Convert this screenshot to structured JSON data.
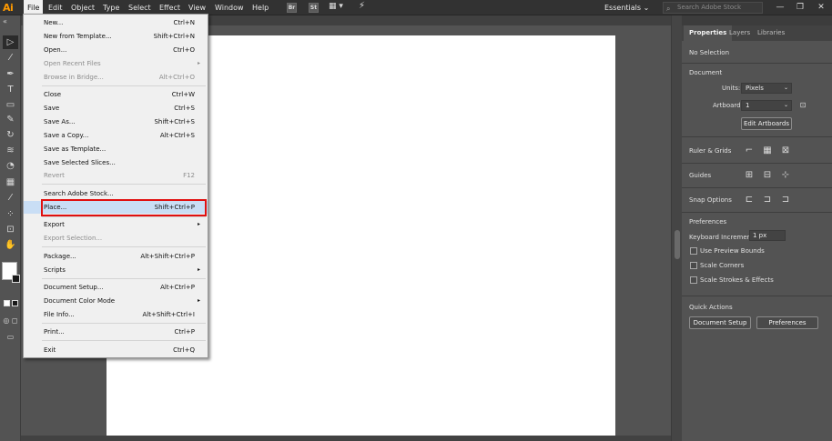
{
  "app": {
    "logo": "Ai"
  },
  "menubar": {
    "items": [
      "File",
      "Edit",
      "Object",
      "Type",
      "Select",
      "Effect",
      "View",
      "Window",
      "Help"
    ],
    "bridge_icon": "Br",
    "stock_icon": "St",
    "workspace": "Essentials",
    "search_placeholder": "Search Adobe Stock",
    "window_controls": [
      "—",
      "❐",
      "✕"
    ]
  },
  "file_menu": {
    "items": [
      {
        "label": "New...",
        "shortcut": "Ctrl+N"
      },
      {
        "label": "New from Template...",
        "shortcut": "Shift+Ctrl+N"
      },
      {
        "label": "Open...",
        "shortcut": "Ctrl+O"
      },
      {
        "label": "Open Recent Files",
        "shortcut": "",
        "submenu": true,
        "disabled": true
      },
      {
        "label": "Browse in Bridge...",
        "shortcut": "Alt+Ctrl+O",
        "disabled": true
      },
      {
        "label": "Close",
        "shortcut": "Ctrl+W"
      },
      {
        "label": "Save",
        "shortcut": "Ctrl+S"
      },
      {
        "label": "Save As...",
        "shortcut": "Shift+Ctrl+S"
      },
      {
        "label": "Save a Copy...",
        "shortcut": "Alt+Ctrl+S"
      },
      {
        "label": "Save as Template...",
        "shortcut": ""
      },
      {
        "label": "Save Selected Slices...",
        "shortcut": ""
      },
      {
        "label": "Revert",
        "shortcut": "F12",
        "disabled": true
      },
      {
        "label": "Search Adobe Stock...",
        "shortcut": ""
      },
      {
        "label": "Place...",
        "shortcut": "Shift+Ctrl+P"
      },
      {
        "label": "Export",
        "shortcut": "",
        "submenu": true
      },
      {
        "label": "Export Selection...",
        "shortcut": "",
        "disabled": true
      },
      {
        "label": "Package...",
        "shortcut": "Alt+Shift+Ctrl+P"
      },
      {
        "label": "Scripts",
        "shortcut": "",
        "submenu": true
      },
      {
        "label": "Document Setup...",
        "shortcut": "Alt+Ctrl+P"
      },
      {
        "label": "Document Color Mode",
        "shortcut": "",
        "submenu": true
      },
      {
        "label": "File Info...",
        "shortcut": "Alt+Shift+Ctrl+I"
      },
      {
        "label": "Print...",
        "shortcut": "Ctrl+P"
      },
      {
        "label": "Exit",
        "shortcut": "Ctrl+Q"
      }
    ]
  },
  "panel": {
    "tabs": [
      "Properties",
      "Layers",
      "Libraries"
    ],
    "no_selection": "No Selection",
    "document_heading": "Document",
    "units_label": "Units:",
    "units_value": "Pixels",
    "artboard_label": "Artboard:",
    "artboard_value": "1",
    "edit_artboards": "Edit Artboards",
    "rulers_grids": "Ruler & Grids",
    "guides": "Guides",
    "snap_options": "Snap Options",
    "preferences_heading": "Preferences",
    "keyboard_increment_label": "Keyboard Increment:",
    "keyboard_increment_value": "1 px",
    "use_preview_bounds": "Use Preview Bounds",
    "scale_corners": "Scale Corners",
    "scale_strokes": "Scale Strokes & Effects",
    "quick_actions": "Quick Actions",
    "document_setup_btn": "Document Setup",
    "preferences_btn": "Preferences"
  }
}
